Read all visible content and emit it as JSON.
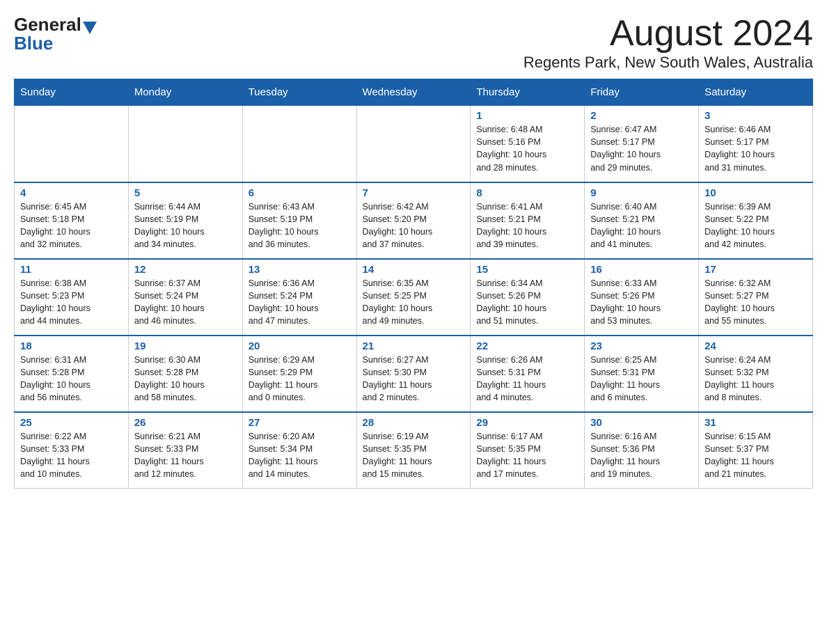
{
  "header": {
    "logo_general": "General",
    "logo_blue": "Blue",
    "month_title": "August 2024",
    "location": "Regents Park, New South Wales, Australia"
  },
  "days_of_week": [
    "Sunday",
    "Monday",
    "Tuesday",
    "Wednesday",
    "Thursday",
    "Friday",
    "Saturday"
  ],
  "weeks": [
    [
      {
        "day": "",
        "info": ""
      },
      {
        "day": "",
        "info": ""
      },
      {
        "day": "",
        "info": ""
      },
      {
        "day": "",
        "info": ""
      },
      {
        "day": "1",
        "info": "Sunrise: 6:48 AM\nSunset: 5:16 PM\nDaylight: 10 hours\nand 28 minutes."
      },
      {
        "day": "2",
        "info": "Sunrise: 6:47 AM\nSunset: 5:17 PM\nDaylight: 10 hours\nand 29 minutes."
      },
      {
        "day": "3",
        "info": "Sunrise: 6:46 AM\nSunset: 5:17 PM\nDaylight: 10 hours\nand 31 minutes."
      }
    ],
    [
      {
        "day": "4",
        "info": "Sunrise: 6:45 AM\nSunset: 5:18 PM\nDaylight: 10 hours\nand 32 minutes."
      },
      {
        "day": "5",
        "info": "Sunrise: 6:44 AM\nSunset: 5:19 PM\nDaylight: 10 hours\nand 34 minutes."
      },
      {
        "day": "6",
        "info": "Sunrise: 6:43 AM\nSunset: 5:19 PM\nDaylight: 10 hours\nand 36 minutes."
      },
      {
        "day": "7",
        "info": "Sunrise: 6:42 AM\nSunset: 5:20 PM\nDaylight: 10 hours\nand 37 minutes."
      },
      {
        "day": "8",
        "info": "Sunrise: 6:41 AM\nSunset: 5:21 PM\nDaylight: 10 hours\nand 39 minutes."
      },
      {
        "day": "9",
        "info": "Sunrise: 6:40 AM\nSunset: 5:21 PM\nDaylight: 10 hours\nand 41 minutes."
      },
      {
        "day": "10",
        "info": "Sunrise: 6:39 AM\nSunset: 5:22 PM\nDaylight: 10 hours\nand 42 minutes."
      }
    ],
    [
      {
        "day": "11",
        "info": "Sunrise: 6:38 AM\nSunset: 5:23 PM\nDaylight: 10 hours\nand 44 minutes."
      },
      {
        "day": "12",
        "info": "Sunrise: 6:37 AM\nSunset: 5:24 PM\nDaylight: 10 hours\nand 46 minutes."
      },
      {
        "day": "13",
        "info": "Sunrise: 6:36 AM\nSunset: 5:24 PM\nDaylight: 10 hours\nand 47 minutes."
      },
      {
        "day": "14",
        "info": "Sunrise: 6:35 AM\nSunset: 5:25 PM\nDaylight: 10 hours\nand 49 minutes."
      },
      {
        "day": "15",
        "info": "Sunrise: 6:34 AM\nSunset: 5:26 PM\nDaylight: 10 hours\nand 51 minutes."
      },
      {
        "day": "16",
        "info": "Sunrise: 6:33 AM\nSunset: 5:26 PM\nDaylight: 10 hours\nand 53 minutes."
      },
      {
        "day": "17",
        "info": "Sunrise: 6:32 AM\nSunset: 5:27 PM\nDaylight: 10 hours\nand 55 minutes."
      }
    ],
    [
      {
        "day": "18",
        "info": "Sunrise: 6:31 AM\nSunset: 5:28 PM\nDaylight: 10 hours\nand 56 minutes."
      },
      {
        "day": "19",
        "info": "Sunrise: 6:30 AM\nSunset: 5:28 PM\nDaylight: 10 hours\nand 58 minutes."
      },
      {
        "day": "20",
        "info": "Sunrise: 6:29 AM\nSunset: 5:29 PM\nDaylight: 11 hours\nand 0 minutes."
      },
      {
        "day": "21",
        "info": "Sunrise: 6:27 AM\nSunset: 5:30 PM\nDaylight: 11 hours\nand 2 minutes."
      },
      {
        "day": "22",
        "info": "Sunrise: 6:26 AM\nSunset: 5:31 PM\nDaylight: 11 hours\nand 4 minutes."
      },
      {
        "day": "23",
        "info": "Sunrise: 6:25 AM\nSunset: 5:31 PM\nDaylight: 11 hours\nand 6 minutes."
      },
      {
        "day": "24",
        "info": "Sunrise: 6:24 AM\nSunset: 5:32 PM\nDaylight: 11 hours\nand 8 minutes."
      }
    ],
    [
      {
        "day": "25",
        "info": "Sunrise: 6:22 AM\nSunset: 5:33 PM\nDaylight: 11 hours\nand 10 minutes."
      },
      {
        "day": "26",
        "info": "Sunrise: 6:21 AM\nSunset: 5:33 PM\nDaylight: 11 hours\nand 12 minutes."
      },
      {
        "day": "27",
        "info": "Sunrise: 6:20 AM\nSunset: 5:34 PM\nDaylight: 11 hours\nand 14 minutes."
      },
      {
        "day": "28",
        "info": "Sunrise: 6:19 AM\nSunset: 5:35 PM\nDaylight: 11 hours\nand 15 minutes."
      },
      {
        "day": "29",
        "info": "Sunrise: 6:17 AM\nSunset: 5:35 PM\nDaylight: 11 hours\nand 17 minutes."
      },
      {
        "day": "30",
        "info": "Sunrise: 6:16 AM\nSunset: 5:36 PM\nDaylight: 11 hours\nand 19 minutes."
      },
      {
        "day": "31",
        "info": "Sunrise: 6:15 AM\nSunset: 5:37 PM\nDaylight: 11 hours\nand 21 minutes."
      }
    ]
  ]
}
